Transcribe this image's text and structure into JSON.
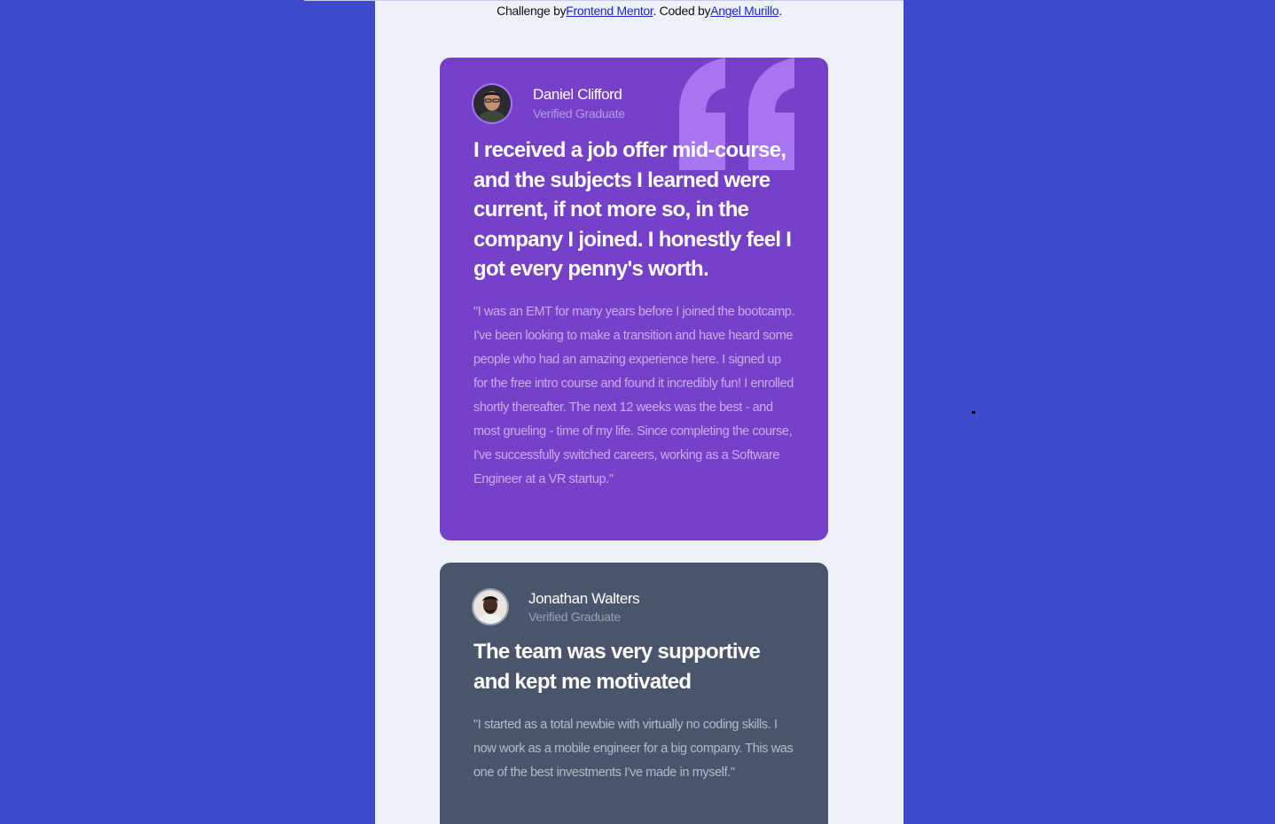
{
  "attribution": {
    "prefix": "Challenge by",
    "link1": "Frontend Mentor",
    "middle": ". Coded by",
    "link2": "Angel Murillo",
    "suffix": "."
  },
  "testimonials": [
    {
      "name": "Daniel Clifford",
      "role": "Verified Graduate",
      "headline": "I received a job offer mid-course, and the subjects I learned were current, if not more so, in the company I joined. I honestly feel I got every penny's worth.",
      "body": "\"I was an EMT for many years before I joined the bootcamp. I've been looking to make a transition and have heard some people who had an amazing experience here. I signed up for the free intro course and found it incredibly fun! I enrolled shortly thereafter. The next 12 weeks was the best - and most grueling - time of my life. Since completing the course, I've successfully switched careers, working as a Software Engineer at a VR startup.\"",
      "card_color": "#7541c8",
      "avatar_icon": "avatar-photo"
    },
    {
      "name": "Jonathan Walters",
      "role": "Verified Graduate",
      "headline": "The team was very supportive and kept me motivated",
      "body": "\"I started as a total newbie with virtually no coding skills. I now work as a mobile engineer for a big company. This was one of the best investments I've made in myself.\"",
      "card_color": "#48556a",
      "avatar_icon": "avatar-photo"
    }
  ],
  "colors": {
    "page_bg": "#3e49cc",
    "column_bg": "#edf2f8",
    "quote_mark": "#a775f1",
    "link": "#1a24d9"
  }
}
